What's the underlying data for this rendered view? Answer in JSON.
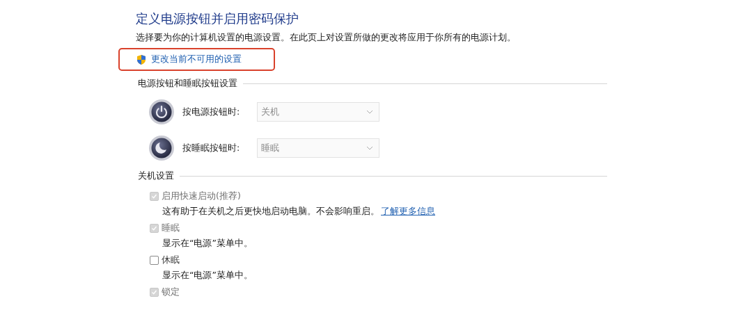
{
  "title": "定义电源按钮并启用密码保护",
  "description": "选择要为你的计算机设置的电源设置。在此页上对设置所做的更改将应用于你所有的电源计划。",
  "admin_link": {
    "label": "更改当前不可用的设置",
    "highlighted": true
  },
  "button_section": {
    "heading": "电源按钮和睡眠按钮设置",
    "rows": [
      {
        "kind": "power",
        "label": "按电源按钮时:",
        "value": "关机",
        "disabled": true
      },
      {
        "kind": "sleep",
        "label": "按睡眠按钮时:",
        "value": "睡眠",
        "disabled": true
      }
    ]
  },
  "shutdown_section": {
    "heading": "关机设置",
    "options": [
      {
        "label": "启用快速启动(推荐)",
        "checked": true,
        "disabled": true,
        "note": "这有助于在关机之后更快地启动电脑。不会影响重启。",
        "link": "了解更多信息"
      },
      {
        "label": "睡眠",
        "checked": true,
        "disabled": true,
        "note": "显示在“电源”菜单中。"
      },
      {
        "label": "休眠",
        "checked": false,
        "disabled": false,
        "note": "显示在“电源”菜单中。"
      },
      {
        "label": "锁定",
        "checked": true,
        "disabled": true
      }
    ]
  }
}
